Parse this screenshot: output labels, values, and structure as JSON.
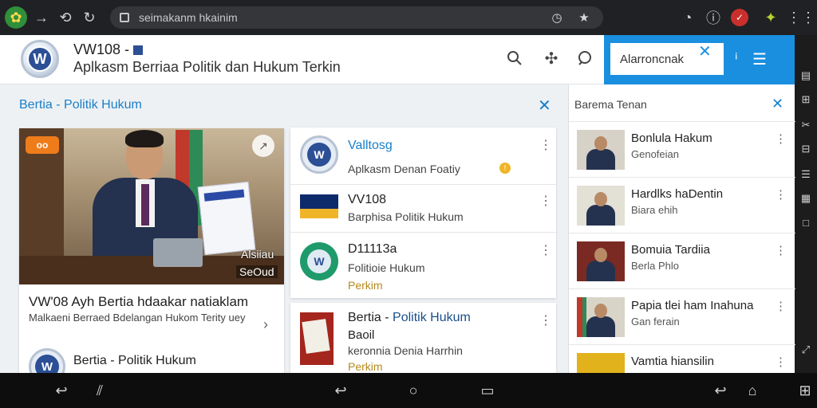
{
  "browser": {
    "url": "seimakanm hkainim",
    "icons": [
      "app-icon",
      "forward-icon",
      "reload-icon",
      "refresh-icon",
      "lock-icon",
      "download-icon",
      "star-icon",
      "clock-icon",
      "info-icon",
      "extension-icon",
      "puzzle-icon",
      "grid-icon"
    ]
  },
  "header": {
    "title": "VW108 -",
    "subtitle": "Aplkasm Berriaa Politik dan Hukum Terkin",
    "logo_text": "W",
    "search": {
      "value": "Alarroncnak"
    }
  },
  "main": {
    "section_title": "Bertia - Politik Hukum",
    "feature": {
      "badge": "oo",
      "img_tag1": "Alsiiau",
      "img_tag2": "SeOud",
      "title": "VW'08 Ayh Bertia hdaakar natiaklam",
      "description": "Malkaeni Berraed Bdelangan Hukom Terity uey",
      "brand_logo_text": "W",
      "brand": "Bertia - Politik Hukum"
    },
    "list": [
      {
        "title": "Valltosg",
        "subtitle": "Aplkasm Denan Foatiy",
        "title_color": "#1a7fc8"
      },
      {
        "title": "VV108",
        "subtitle": "Barphisa Politik Hukum",
        "title_color": "#222222"
      },
      {
        "title": "D11113a",
        "subtitle": "Folitioie Hukum",
        "extra": "Perkim",
        "title_color": "#222222"
      }
    ],
    "card2": {
      "title_a": "Bertia - ",
      "title_b": "Politik Hukum",
      "line2": "Baoil",
      "line3": "keronnia Denia Harrhin",
      "line4": "Perkim"
    }
  },
  "news_pane": {
    "title": "Barema Tenan",
    "items": [
      {
        "title": "Bonlula Hakum",
        "subtitle": "Genofeian"
      },
      {
        "title": "Hardlks haDentin",
        "subtitle": "Biara ehih"
      },
      {
        "title": "Bomuia Tardiia",
        "subtitle": "Berla Phlo"
      },
      {
        "title": "Papia tlei ham Inahuna",
        "subtitle": "Gan ferain"
      },
      {
        "title": "Vamtia hiansilin",
        "subtitle": ""
      }
    ]
  },
  "colors": {
    "accent": "#1a7fc8",
    "search_panel": "#1a8fe0",
    "badge": "#ee7c1b"
  }
}
